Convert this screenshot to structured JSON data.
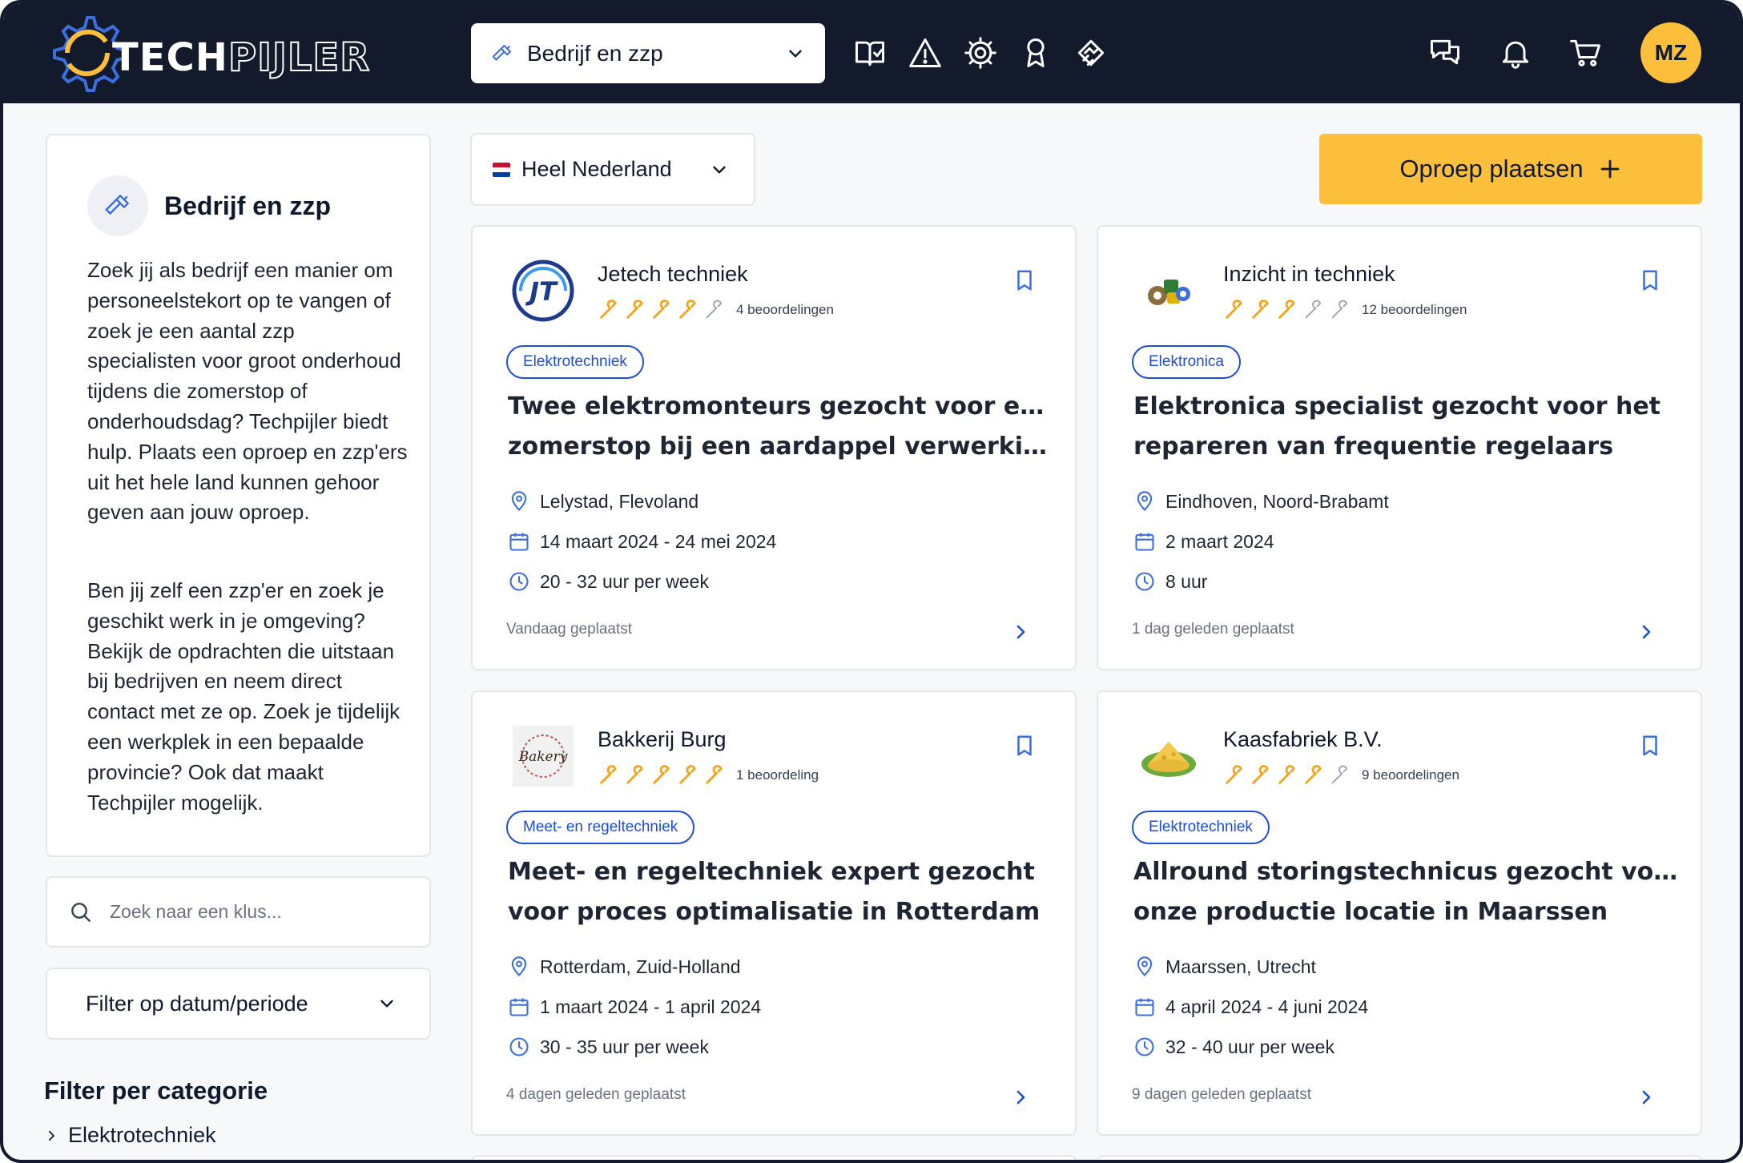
{
  "app": {
    "brand_part1": "TECH",
    "brand_part2": "PIJLER",
    "role_select": "Bedrijf en zzp",
    "nav_icons": [
      "book-check-icon",
      "warning-icon",
      "settings-icon",
      "award-icon",
      "handshake-icon"
    ],
    "right_icons": [
      "chat-icon",
      "bell-icon",
      "cart-icon"
    ],
    "avatar_initials": "MZ"
  },
  "sidebar": {
    "intro_title": "Bedrijf en zzp",
    "intro_p1": "Zoek jij als bedrijf een manier om personeelstekort op te vangen of zoek je een aantal zzp specialisten voor groot onderhoud tijdens die zomerstop of onderhoudsdag? Techpijler biedt hulp. Plaats een oproep en zzp'ers uit het hele land kunnen gehoor geven aan jouw oproep.",
    "intro_p2": "Ben jij zelf een zzp'er en zoek je geschikt werk in je omgeving? Bekijk de opdrachten die uitstaan bij bedrijven en neem direct contact met ze op. Zoek je tijdelijk een werkplek in een bepaalde provincie? Ook dat maakt Techpijler mogelijk.",
    "search_placeholder": "Zoek naar een klus...",
    "date_filter": "Filter op datum/periode",
    "category_title": "Filter per categorie",
    "categories": [
      "Elektrotechniek"
    ]
  },
  "main": {
    "region": "Heel Nederland",
    "cta_label": "Oproep plaatsen",
    "jobs": [
      {
        "company": "Jetech techniek",
        "rating": 4,
        "rating_max": 5,
        "reviews": "4 beoordelingen",
        "tag": "Elektrotechniek",
        "title_l1": "Twee elektromonteurs gezocht voor een",
        "title_l2": "zomerstop bij een aardappel verwerking...",
        "location": "Lelystad, Flevoland",
        "period": "14 maart 2024 - 24 mei 2024",
        "hours": "20 - 32 uur per week",
        "posted": "Vandaag geplaatst"
      },
      {
        "company": "Inzicht in techniek",
        "rating": 3,
        "rating_max": 5,
        "reviews": "12 beoordelingen",
        "tag": "Elektronica",
        "title_l1": "Elektronica specialist gezocht voor het",
        "title_l2": "repareren van frequentie regelaars",
        "location": "Eindhoven, Noord-Brabamt",
        "period": "2 maart 2024",
        "hours": "8 uur",
        "posted": "1 dag geleden geplaatst"
      },
      {
        "company": "Bakkerij Burg",
        "rating": 5,
        "rating_max": 5,
        "reviews": "1 beoordeling",
        "tag": "Meet- en regeltechniek",
        "title_l1": "Meet- en regeltechniek expert gezocht",
        "title_l2": "voor proces optimalisatie in Rotterdam",
        "location": "Rotterdam, Zuid-Holland",
        "period": "1 maart 2024 - 1 april 2024",
        "hours": "30 - 35 uur per week",
        "posted": "4 dagen geleden geplaatst"
      },
      {
        "company": "Kaasfabriek B.V.",
        "rating": 4,
        "rating_max": 5,
        "reviews": "9 beoordelingen",
        "tag": "Elektrotechniek",
        "title_l1": "Allround storingstechnicus gezocht voor",
        "title_l2": "onze productie locatie in Maarssen",
        "location": "Maarssen, Utrecht",
        "period": "4 april 2024 - 4 juni 2024",
        "hours": "32 - 40 uur per week",
        "posted": "9 dagen geleden geplaatst"
      }
    ]
  },
  "colors": {
    "header_bg": "#121a2c",
    "accent_yellow": "#fbbf3c",
    "tag_blue": "#1d4ed8",
    "icon_blue": "#3b6fe0",
    "page_bg": "#f7f8fa"
  }
}
